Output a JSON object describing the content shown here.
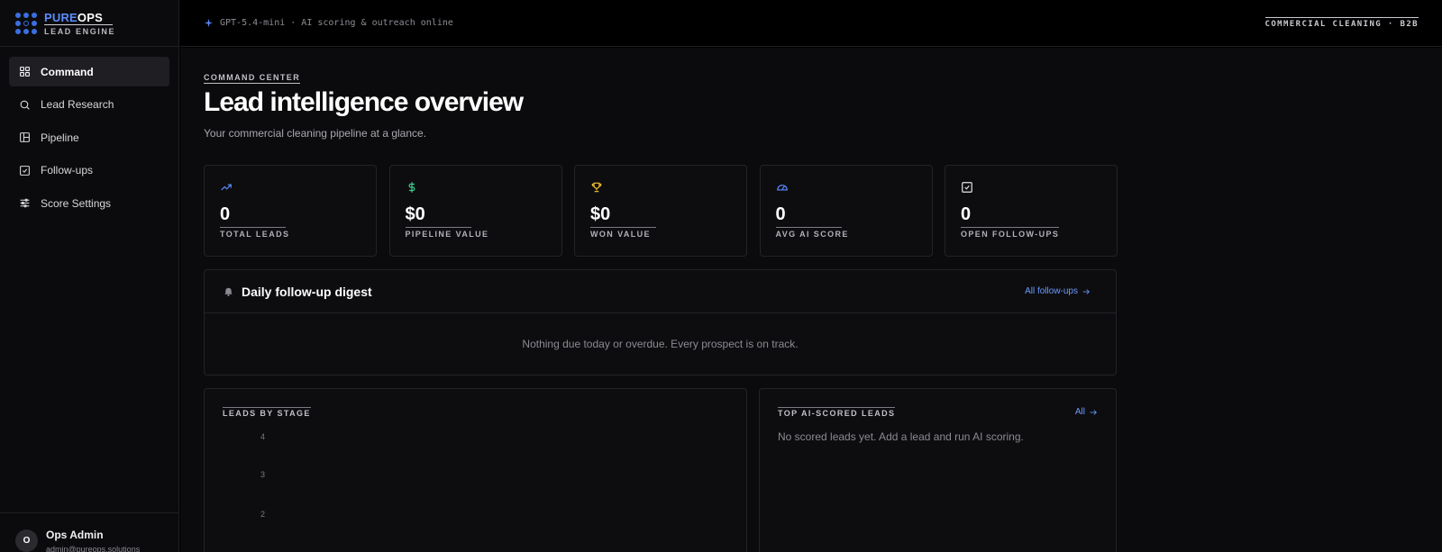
{
  "brand": {
    "name_part1": "PURE",
    "name_part2": "OPS",
    "subtitle": "LEAD ENGINE"
  },
  "nav": [
    {
      "label": "Command",
      "icon": "grid-icon",
      "active": true
    },
    {
      "label": "Lead Research",
      "icon": "search-icon",
      "active": false
    },
    {
      "label": "Pipeline",
      "icon": "kanban-icon",
      "active": false
    },
    {
      "label": "Follow-ups",
      "icon": "checkbox-icon",
      "active": false
    },
    {
      "label": "Score Settings",
      "icon": "sliders-icon",
      "active": false
    }
  ],
  "user": {
    "initial": "O",
    "name": "Ops Admin",
    "email": "admin@pureops.solutions"
  },
  "topbar": {
    "status": "GPT-5.4-mini · AI scoring & outreach online",
    "segment": "COMMERCIAL CLEANING · B2B"
  },
  "header": {
    "eyebrow": "COMMAND CENTER",
    "title": "Lead intelligence overview",
    "subtitle": "Your commercial cleaning pipeline at a glance."
  },
  "stats": [
    {
      "icon": "trend-up-icon",
      "color": "#5b8cff",
      "value": "0",
      "label": "TOTAL LEADS"
    },
    {
      "icon": "dollar-icon",
      "color": "#3ecf8e",
      "value": "$0",
      "label": "PIPELINE VALUE"
    },
    {
      "icon": "trophy-icon",
      "color": "#f2c230",
      "value": "$0",
      "label": "WON VALUE"
    },
    {
      "icon": "gauge-icon",
      "color": "#5b8cff",
      "value": "0",
      "label": "AVG AI SCORE"
    },
    {
      "icon": "check-square-icon",
      "color": "#e8e8ea",
      "value": "0",
      "label": "OPEN FOLLOW-UPS"
    }
  ],
  "digest": {
    "title": "Daily follow-up digest",
    "link": "All follow-ups",
    "empty": "Nothing due today or overdue. Every prospect is on track."
  },
  "leads_by_stage": {
    "title": "LEADS BY STAGE",
    "ticks": [
      "4",
      "3",
      "2"
    ]
  },
  "top_leads": {
    "title": "TOP AI-SCORED LEADS",
    "link": "All",
    "empty": "No scored leads yet. Add a lead and run AI scoring."
  }
}
